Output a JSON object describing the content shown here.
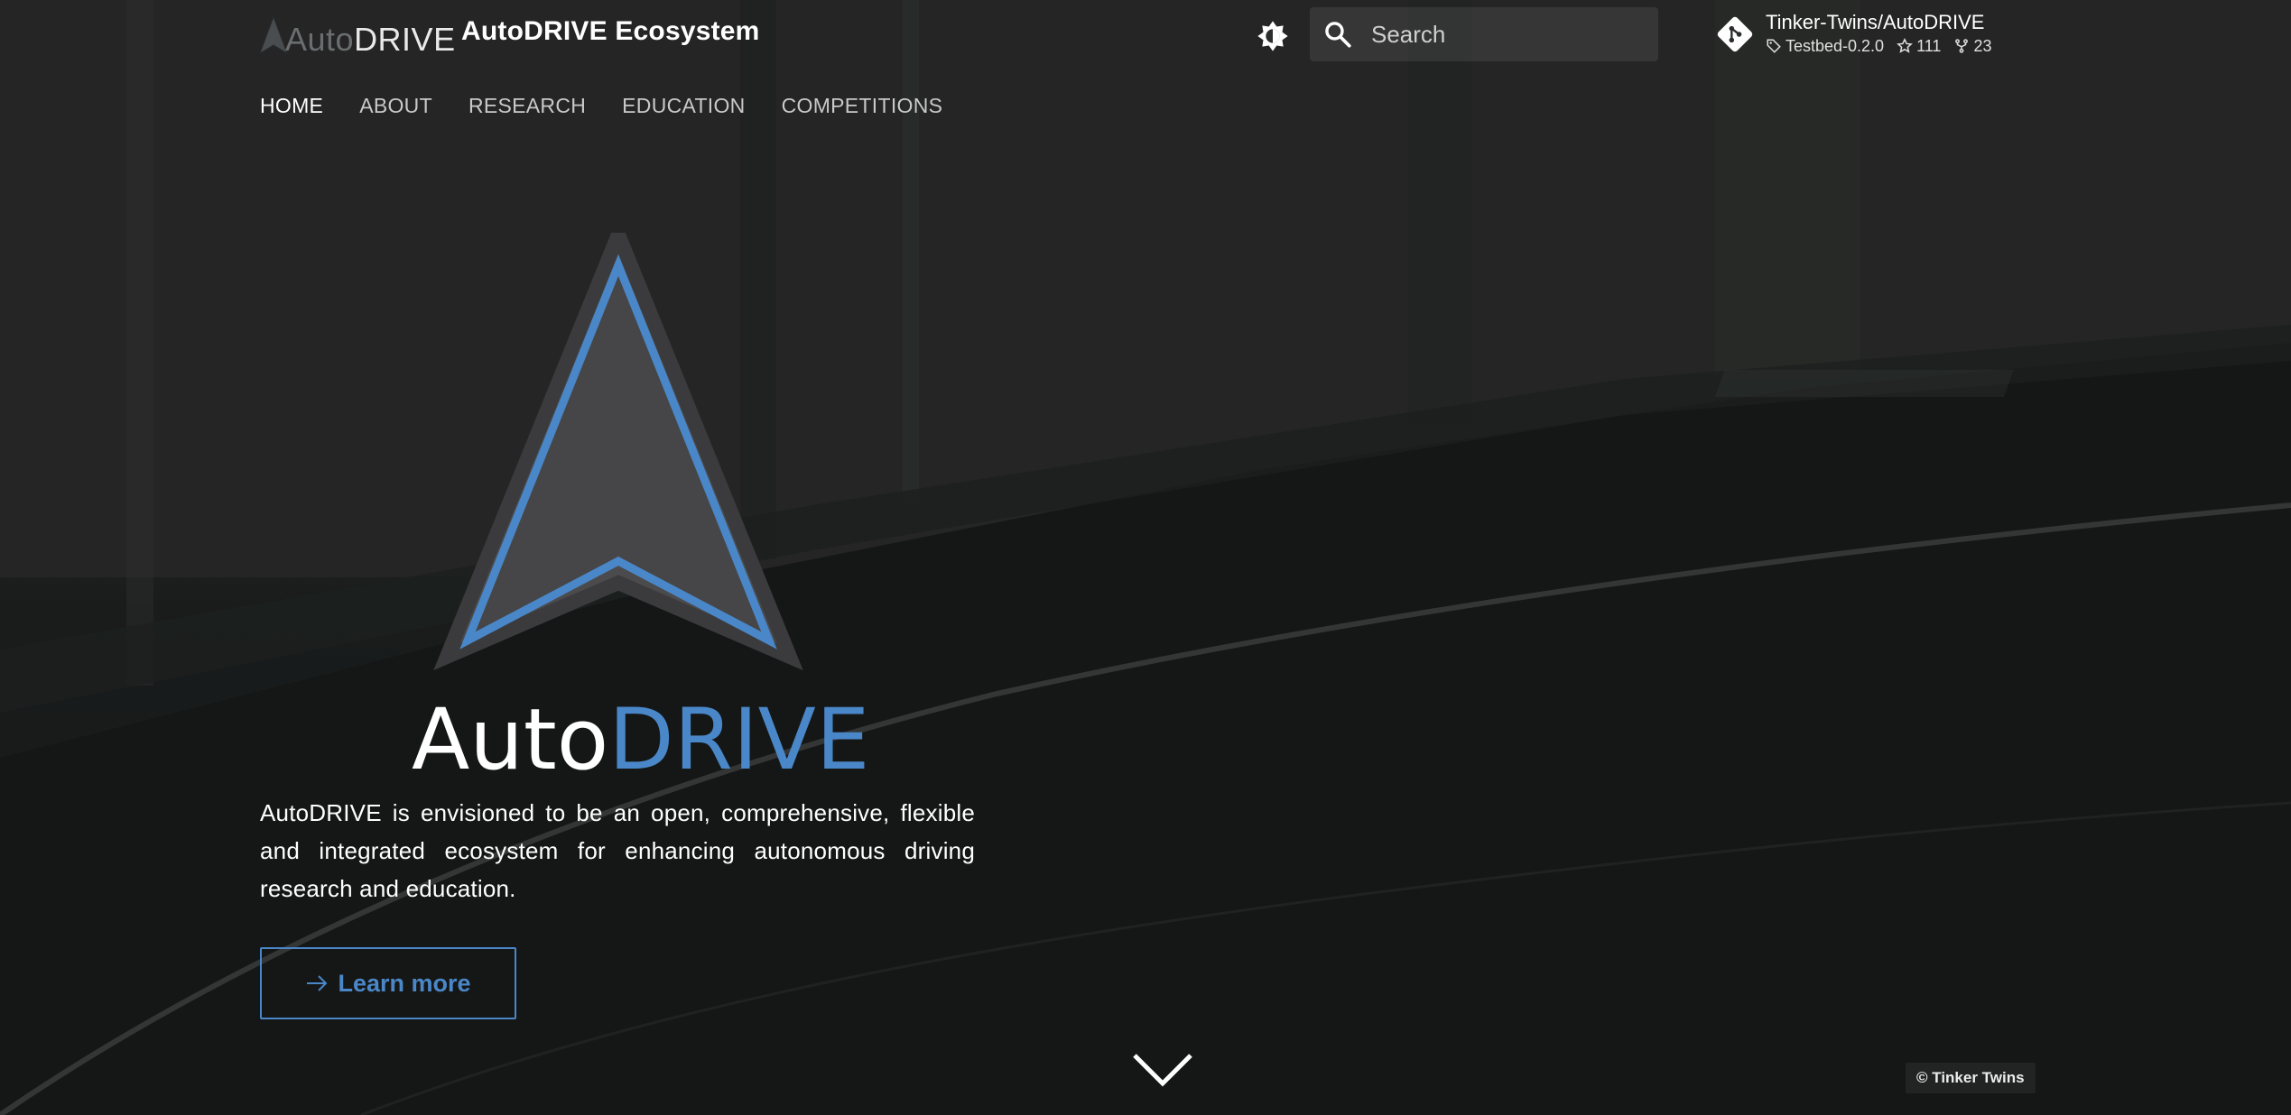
{
  "header": {
    "logo_auto": "Auto",
    "logo_drive": "DRIVE",
    "site_title": "AutoDRIVE Ecosystem",
    "search_placeholder": "Search",
    "repo": {
      "name": "Tinker-Twins/AutoDRIVE",
      "version": "Testbed-0.2.0",
      "stars": "111",
      "forks": "23"
    }
  },
  "nav": {
    "tabs": [
      {
        "label": "HOME",
        "active": true
      },
      {
        "label": "ABOUT",
        "active": false
      },
      {
        "label": "RESEARCH",
        "active": false
      },
      {
        "label": "EDUCATION",
        "active": false
      },
      {
        "label": "COMPETITIONS",
        "active": false
      }
    ]
  },
  "hero": {
    "wordmark_auto": "Auto",
    "wordmark_drive": "DRIVE",
    "description": "AutoDRIVE is envisioned to be an open, comprehensive, flexible and integrated ecosystem for enhancing autonomous driving research and education.",
    "cta_label": "Learn more"
  },
  "footer": {
    "copyright": "© Tinker Twins"
  },
  "colors": {
    "accent": "#4a87c8",
    "text": "#ffffff",
    "background": "#1e1f1f"
  },
  "icons": {
    "theme": "brightness-icon",
    "search": "search-icon",
    "repo": "git-icon",
    "tag": "tag-icon",
    "star": "star-icon",
    "fork": "fork-icon",
    "cta": "arrow-right-icon",
    "scroll": "chevron-down-icon"
  }
}
